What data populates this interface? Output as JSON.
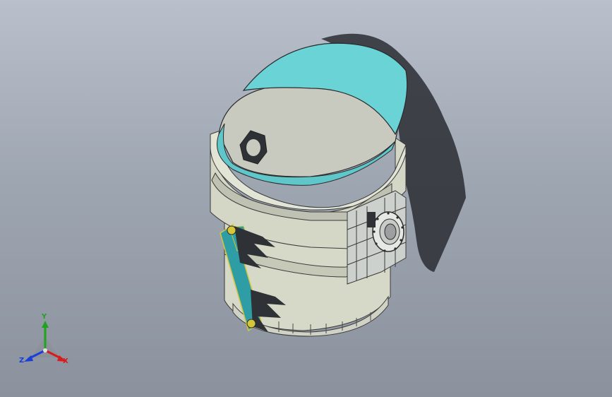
{
  "triad": {
    "x_label": "X",
    "y_label": "Y",
    "z_label": "Z",
    "colors": {
      "x": "#d81b1b",
      "y": "#1fa31f",
      "z": "#1a3fd8"
    }
  },
  "model": {
    "colors": {
      "body": "#d9dccb",
      "body_shade": "#b9bcaa",
      "hopper_outer": "#6ad3d6",
      "hopper_inner": "#c9cac0",
      "frame": "#c9cec9",
      "dark_part": "#2e3236",
      "link_arm": "#2f9da5",
      "shadow": "#2a2d33"
    }
  }
}
